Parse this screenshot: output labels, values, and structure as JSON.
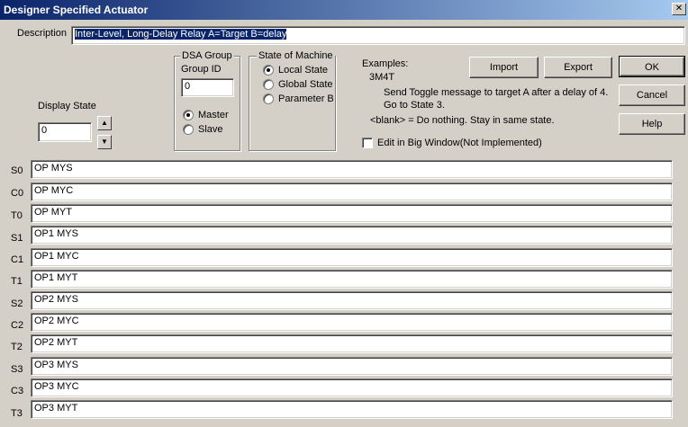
{
  "window": {
    "title": "Designer Specified Actuator",
    "close_glyph": "✕"
  },
  "description": {
    "label": "Description",
    "value": "Inter-Level, Long-Delay Relay A=Target B=delay"
  },
  "display_state": {
    "label": "Display State",
    "value": "0",
    "up_glyph": "▲",
    "down_glyph": "▼"
  },
  "dsa_group": {
    "legend": "DSA Group",
    "group_id_label": "Group ID",
    "group_id_value": "0",
    "options": [
      {
        "label": "Master",
        "selected": true
      },
      {
        "label": "Slave",
        "selected": false
      }
    ]
  },
  "state_of_machine": {
    "legend": "State of Machine",
    "options": [
      {
        "label": "Local State",
        "selected": true
      },
      {
        "label": "Global State",
        "selected": false
      },
      {
        "label": "Parameter B",
        "selected": false
      }
    ]
  },
  "examples": {
    "heading": "Examples:",
    "code": "3M4T",
    "line1": "Send Toggle message to target A after a delay of 4.",
    "line2": "Go to State 3.",
    "blank_note": "<blank> = Do nothing.  Stay in same state."
  },
  "big_window": {
    "label": "Edit in Big Window(Not Implemented)",
    "checked": false
  },
  "buttons": {
    "import": "Import",
    "export": "Export",
    "ok": "OK",
    "cancel": "Cancel",
    "help": "Help"
  },
  "rows": [
    {
      "label": "S0",
      "value": "OP MYS"
    },
    {
      "label": "C0",
      "value": "OP MYC"
    },
    {
      "label": "T0",
      "value": "OP MYT"
    },
    {
      "label": "S1",
      "value": "OP1 MYS"
    },
    {
      "label": "C1",
      "value": "OP1 MYC"
    },
    {
      "label": "T1",
      "value": "OP1 MYT"
    },
    {
      "label": "S2",
      "value": "OP2 MYS"
    },
    {
      "label": "C2",
      "value": "OP2 MYC"
    },
    {
      "label": "T2",
      "value": "OP2 MYT"
    },
    {
      "label": "S3",
      "value": "OP3 MYS"
    },
    {
      "label": "C3",
      "value": "OP3 MYC"
    },
    {
      "label": "T3",
      "value": "OP3 MYT"
    }
  ]
}
